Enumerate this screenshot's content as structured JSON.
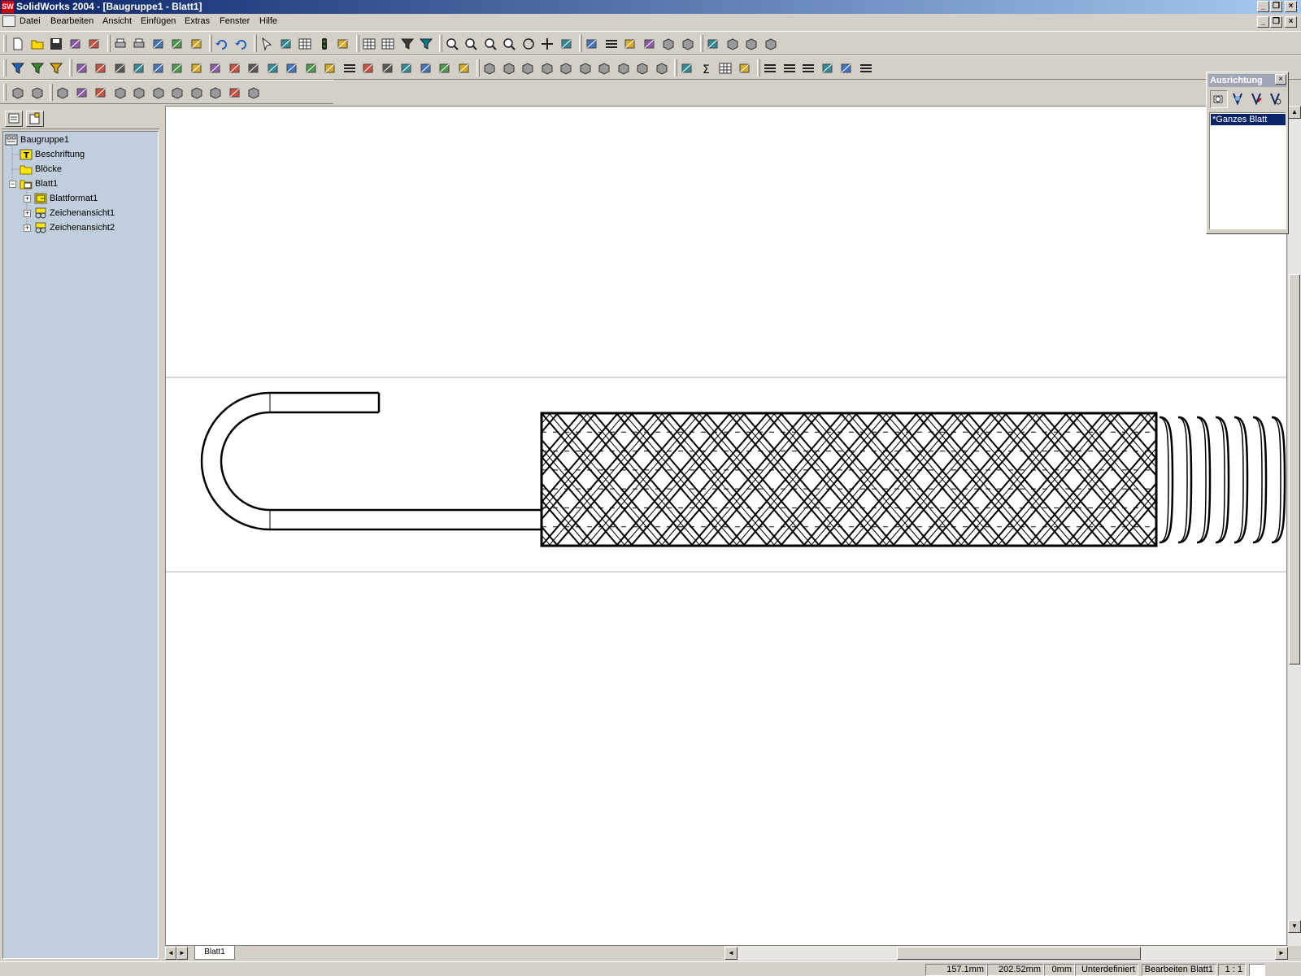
{
  "window": {
    "title": "SolidWorks 2004 - [Baugruppe1 - Blatt1]",
    "app_icon": "solidworks-icon"
  },
  "menu": [
    "Datei",
    "Bearbeiten",
    "Ansicht",
    "Einfügen",
    "Extras",
    "Fenster",
    "Hilfe"
  ],
  "toolbar_icons": {
    "row1": [
      "new-icon",
      "open-icon",
      "save-icon",
      "make-drawing-icon",
      "make-assembly-icon",
      "print-icon",
      "print-preview-icon",
      "cut-icon",
      "copy-icon",
      "paste-icon",
      "undo-icon",
      "redo-icon",
      "select-icon",
      "sketch-icon",
      "grid-icon",
      "traffic-light-icon",
      "rebuild-icon",
      "table-icon",
      "table2-icon",
      "select-filter-icon",
      "select-filter2-icon",
      "zoom-fit-icon",
      "zoom-area-icon",
      "zoom-inout-icon",
      "zoom-selection-icon",
      "rotate-icon",
      "pan-icon",
      "view-orientation-icon",
      "wireframe-icon",
      "hidden-lines-icon",
      "hidden-removed-icon",
      "draft-icon",
      "shaded-edges-icon",
      "shaded-icon",
      "perspective-icon",
      "section-view-icon",
      "shadows-icon",
      "real-view-icon"
    ],
    "row2": [
      "filter-icon",
      "filter-edges-icon",
      "filter-faces-icon",
      "dim-icon",
      "dim2-icon",
      "dim3-icon",
      "note-icon",
      "balloon-icon",
      "auto-balloon-icon",
      "weld-symbol-icon",
      "surface-finish-icon",
      "datum-icon",
      "geometric-tolerance-icon",
      "datum-target-icon",
      "hole-callout-icon",
      "cosmetic-thread-icon",
      "center-mark-icon",
      "centerline-icon",
      "hatch-icon",
      "block-icon",
      "area-hatch-icon",
      "revision-icon",
      "weld-bead-icon",
      "bom-icon",
      "view-icon1",
      "view-icon2",
      "view-icon3",
      "view-icon4",
      "view-icon5",
      "view-icon6",
      "view-icon7",
      "view-icon8",
      "view-icon9",
      "view-icon10",
      "measure-icon",
      "sum-icon",
      "table-icon3",
      "layer-icon",
      "line-style-icon",
      "line-thickness-icon",
      "line-color-icon",
      "color-icon",
      "hide-edges-icon",
      "line-format-icon"
    ],
    "row3": [
      "model-view-icon",
      "projected-view-icon",
      "aux-view-icon",
      "section-view2-icon",
      "aligned-section-icon",
      "detail-view-icon",
      "broken-view-icon",
      "crop-view-icon",
      "predefined-view-icon",
      "empty-view-icon",
      "relative-view-icon",
      "alternate-position-icon",
      "update-view-icon"
    ]
  },
  "feature_tree": {
    "tabs": [
      "featuremanager-tab-icon",
      "propertymanager-tab-icon"
    ],
    "items": [
      {
        "label": "Baugruppe1",
        "icon": "drawing-icon"
      },
      {
        "label": "Beschriftung",
        "icon": "annotations-icon"
      },
      {
        "label": "Blöcke",
        "icon": "folder-icon"
      },
      {
        "label": "Blatt1",
        "icon": "sheet-icon"
      },
      {
        "label": "Blattformat1",
        "icon": "sheet-format-icon"
      },
      {
        "label": "Zeichenansicht1",
        "icon": "drawing-view-icon"
      },
      {
        "label": "Zeichenansicht2",
        "icon": "drawing-view-icon"
      }
    ]
  },
  "orientation_panel": {
    "title": "Ausrichtung",
    "selected": "*Ganzes Blatt"
  },
  "sheet_tabs": [
    "Blatt1"
  ],
  "status": {
    "x": "157.1mm",
    "y": "202.52mm",
    "z": "0mm",
    "state": "Unterdefiniert",
    "mode": "Bearbeiten Blatt1",
    "scale": "1 : 1"
  }
}
